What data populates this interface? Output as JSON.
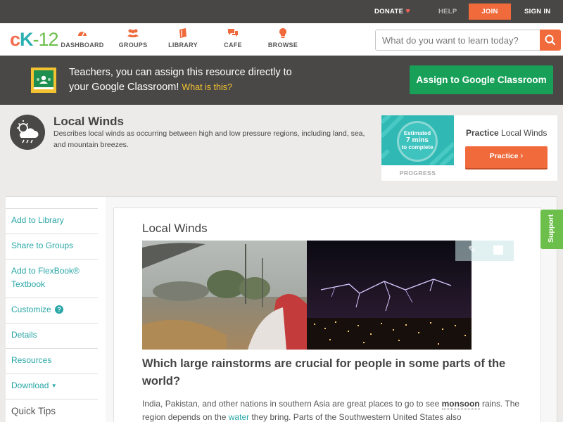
{
  "topbar": {
    "donate": "DONATE",
    "help": "HELP",
    "join": "JOIN",
    "signin": "SIGN IN"
  },
  "header": {
    "logo_c": "c",
    "logo_k": "K",
    "logo_n": "-12",
    "nav": [
      {
        "label": "DASHBOARD",
        "icon": "dashboard-icon"
      },
      {
        "label": "GROUPS",
        "icon": "groups-icon"
      },
      {
        "label": "LIBRARY",
        "icon": "library-icon"
      },
      {
        "label": "CAFE",
        "icon": "cafe-icon"
      },
      {
        "label": "BROWSE",
        "icon": "browse-icon"
      }
    ],
    "search_placeholder": "What do you want to learn today?"
  },
  "classroom": {
    "line1": "Teachers, you can assign this resource directly to",
    "line2": "your Google Classroom!",
    "link": "What is this?",
    "button": "Assign to Google Classroom"
  },
  "concept": {
    "title": "Local Winds",
    "description": "Describes local winds as occurring between high and low pressure regions, including land, sea, and mountain breezes."
  },
  "practice": {
    "estimated": "Estimated",
    "mins": "7 mins",
    "complete": "to complete",
    "progress_label": "PROGRESS",
    "title_bold": "Practice",
    "title_rest": " Local Winds",
    "button": "Practice"
  },
  "sidebar": {
    "items": [
      "Add to Library",
      "Share to Groups",
      "Add to FlexBook® Textbook",
      "Customize",
      "Details",
      "Resources",
      "Download"
    ],
    "customize_badge": "?",
    "quick_tips": "Quick Tips"
  },
  "content": {
    "title": "Local Winds",
    "question": "Which large rainstorms are crucial for people in some parts of the world?",
    "para_1": "India, Pakistan, and other nations in southern Asia are great places to go to see ",
    "para_kw": "monsoon",
    "para_2": " rains. The region depends on the ",
    "para_link": "water",
    "para_3": " they bring. Parts of the Southwestern United States also"
  },
  "support": "Support",
  "colors": {
    "accent_orange": "#f06a3b",
    "teal": "#2aa6a7",
    "google_green": "#18a058",
    "support_green": "#6cbf4a"
  }
}
